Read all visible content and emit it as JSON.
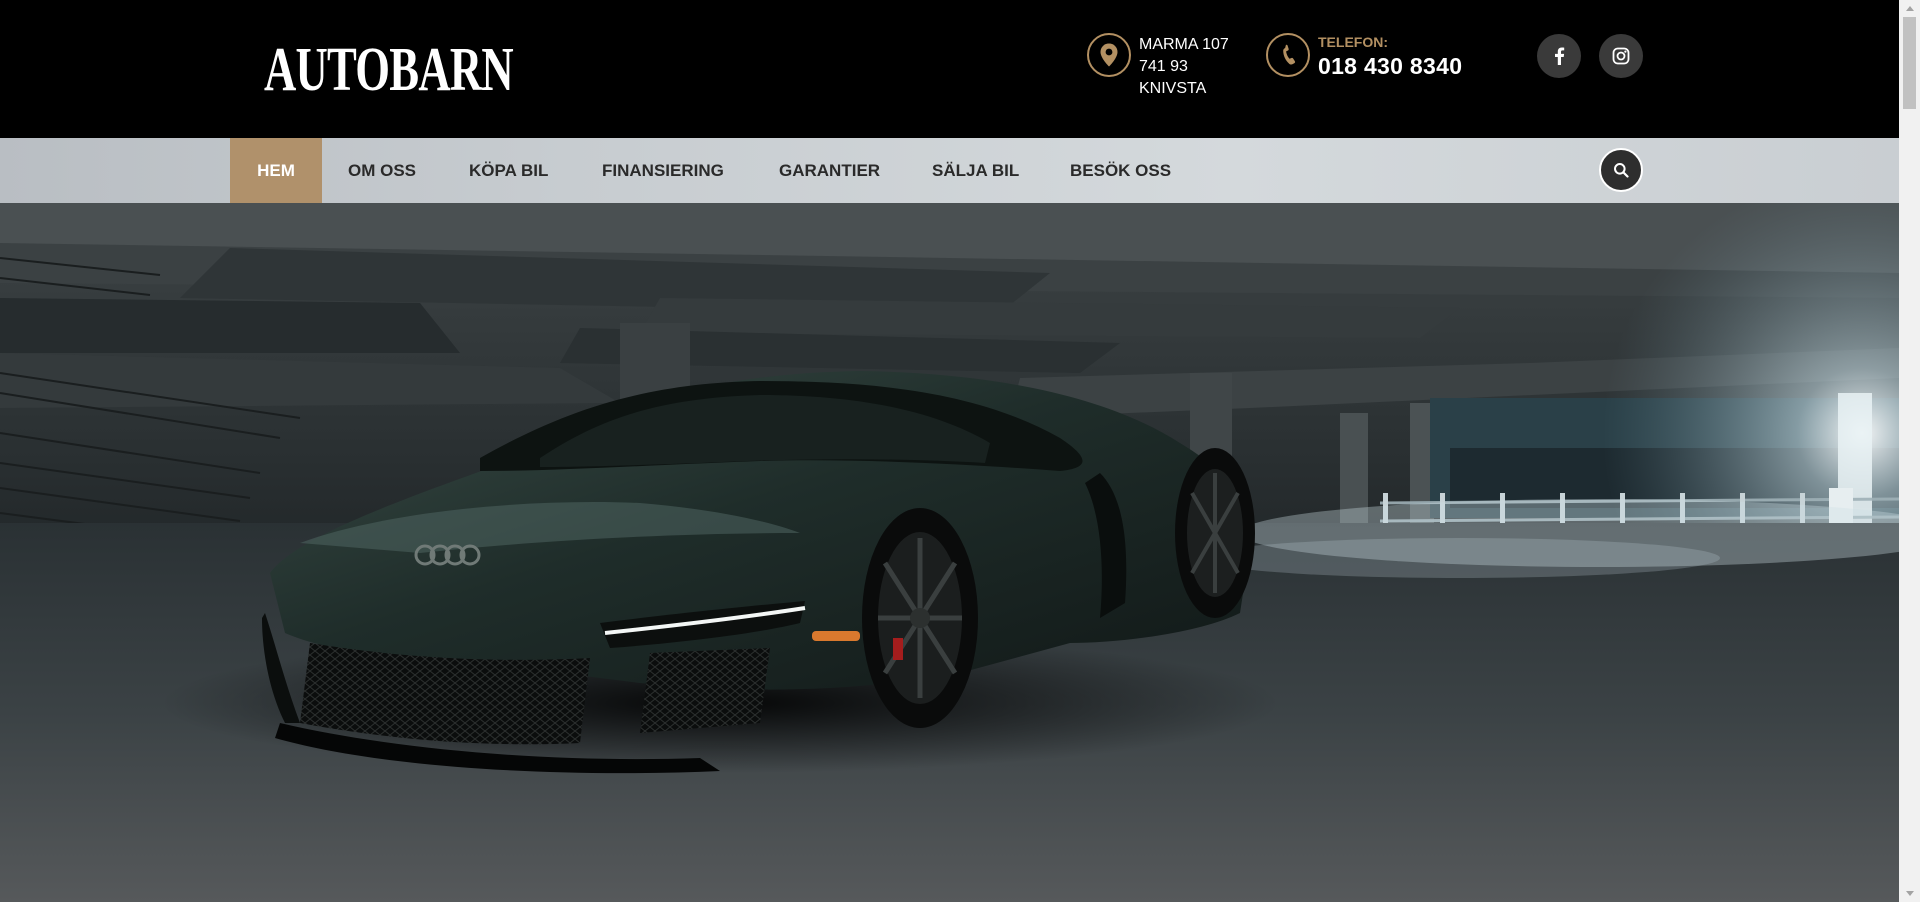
{
  "brand": {
    "logo_text": "AUTOBARN"
  },
  "header": {
    "address_lines": [
      "MARMA 107",
      "741 93",
      "KNIVSTA"
    ],
    "phone_label": "TELEFON:",
    "phone_number": "018 430 8340"
  },
  "icons": {
    "address": "map-pin-icon",
    "phone": "phone-icon",
    "facebook": "facebook-icon",
    "instagram": "instagram-icon",
    "search": "search-icon"
  },
  "nav": {
    "items": [
      {
        "label": "HEM",
        "active": true
      },
      {
        "label": "OM OSS",
        "active": false
      },
      {
        "label": "KÖPA BIL",
        "active": false
      },
      {
        "label": "FINANSIERING",
        "active": false
      },
      {
        "label": "GARANTIER",
        "active": false
      },
      {
        "label": "SÄLJA BIL",
        "active": false
      },
      {
        "label": "BESÖK OSS",
        "active": false
      }
    ]
  },
  "hero": {
    "image": "dark green sports car in a parking garage"
  },
  "colors": {
    "accent": "#b0916b",
    "header_bg": "#000000",
    "nav_bg": "#c7ccd0",
    "nav_text": "#2a2a2a"
  }
}
